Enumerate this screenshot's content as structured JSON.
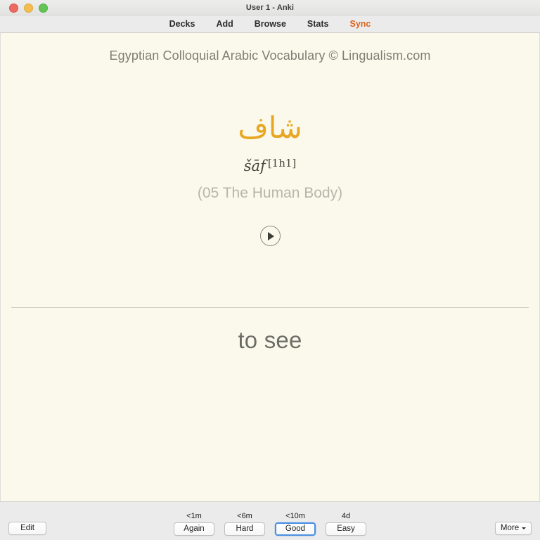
{
  "window": {
    "title": "User 1 - Anki",
    "traffic_lights": [
      "close",
      "minimize",
      "maximize"
    ]
  },
  "menubar": {
    "items": [
      {
        "label": "Decks",
        "accent": false
      },
      {
        "label": "Add",
        "accent": false
      },
      {
        "label": "Browse",
        "accent": false
      },
      {
        "label": "Stats",
        "accent": false
      },
      {
        "label": "Sync",
        "accent": true
      }
    ],
    "sync_color": "#d9641e"
  },
  "card": {
    "deck_header": "Egyptian Colloquial Arabic Vocabulary © Lingualism.com",
    "headword": "شاف",
    "headword_color": "#e8a723",
    "transliteration": "šāf",
    "transliteration_tag": "[1h1]",
    "category": "(05 The Human Body)",
    "play_icon": "play-icon",
    "answer": "to see"
  },
  "bottombar": {
    "edit_label": "Edit",
    "more_label": "More",
    "more_caret_icon": "chevron-down-icon",
    "answers": [
      {
        "interval": "<1m",
        "label": "Again",
        "selected": false
      },
      {
        "interval": "<6m",
        "label": "Hard",
        "selected": false
      },
      {
        "interval": "<10m",
        "label": "Good",
        "selected": true
      },
      {
        "interval": "4d",
        "label": "Easy",
        "selected": false
      }
    ],
    "selected_color": "#4a90e2"
  }
}
